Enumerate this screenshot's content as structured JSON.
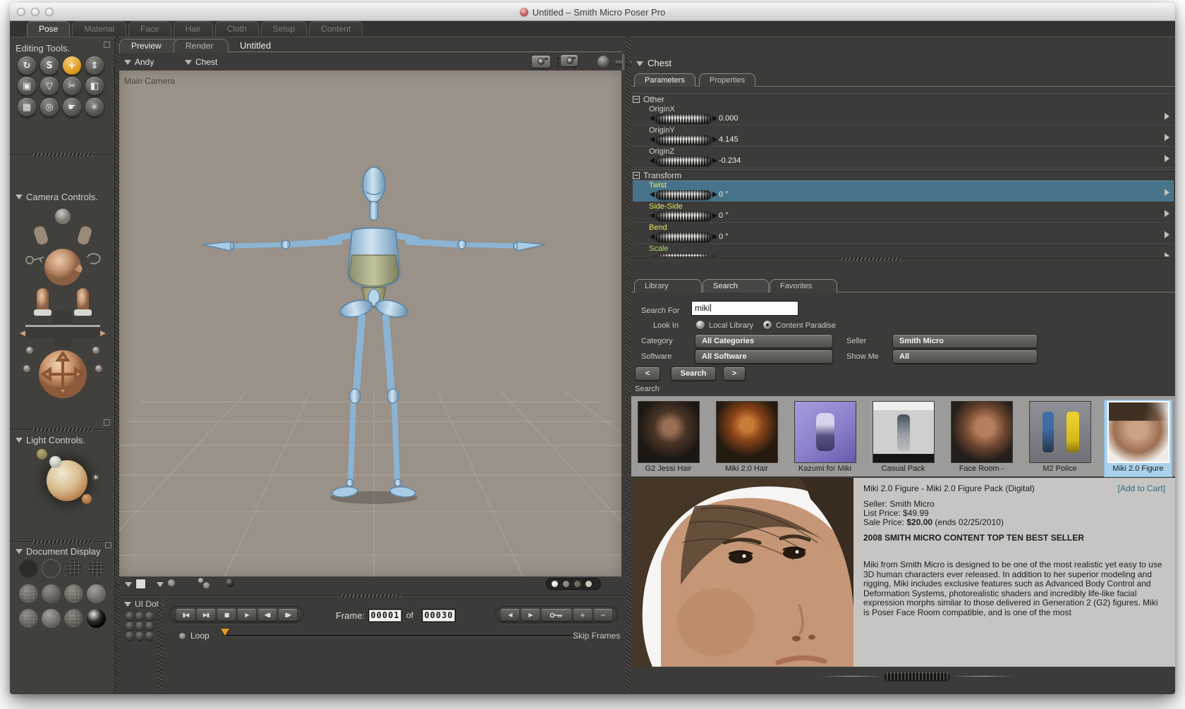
{
  "window": {
    "title": "Untitled – Smith Micro Poser Pro"
  },
  "main_tabs": {
    "items": [
      "Pose",
      "Material",
      "Face",
      "Hair",
      "Cloth",
      "Setup",
      "Content"
    ],
    "active": "Pose"
  },
  "sidebar": {
    "editing_tools_label": "Editing Tools.",
    "camera_controls_label": "Camera Controls.",
    "light_controls_label": "Light Controls.",
    "document_display_label": "Document Display"
  },
  "icons": {
    "rotate": "↻",
    "twist": "S",
    "translate": "+",
    "translate_in_out": "⇕",
    "scale": "▣",
    "taper": "▽",
    "chain_break": "✂",
    "color": "◧",
    "morph": "▦",
    "magnify": "◎",
    "group": "☛",
    "direct_manipulation": "✳",
    "sun": "☀",
    "prev": "◀",
    "next": "▶",
    "plus": "+",
    "minus": "−"
  },
  "document": {
    "tabs": [
      "Preview",
      "Render"
    ],
    "active_tab": "Preview",
    "title": "Untitled",
    "figure": "Andy",
    "element": "Chest",
    "camera_label": "Main Camera"
  },
  "animation": {
    "ui_dots_label": "UI Dots",
    "transport_icons": [
      "▮◀",
      "▶▮",
      "■",
      "▶",
      "◀▮",
      "▮▶"
    ],
    "frame_label": "Frame:",
    "current": "00001",
    "of_label": "of",
    "total": "00030",
    "loop_label": "Loop",
    "skip_frames_label": "Skip Frames"
  },
  "parameters": {
    "element": "Chest",
    "tabs": [
      "Parameters",
      "Properties"
    ],
    "active_tab": "Parameters",
    "selected_param": "Twist",
    "groups": [
      {
        "name": "Other",
        "params": [
          {
            "label": "OriginX",
            "value": "0.000"
          },
          {
            "label": "OriginY",
            "value": "4.145"
          },
          {
            "label": "OriginZ",
            "value": "-0.234"
          }
        ]
      },
      {
        "name": "Transform",
        "params": [
          {
            "label": "Twist",
            "value": "0 °"
          },
          {
            "label": "Side-Side",
            "value": "0 °"
          },
          {
            "label": "Bend",
            "value": "0 °"
          },
          {
            "label": "Scale",
            "value": ""
          }
        ]
      }
    ]
  },
  "library": {
    "tabs": [
      "Library",
      "Search",
      "Favorites"
    ],
    "active_tab": "Search",
    "search_form": {
      "search_for_label": "Search For",
      "query": "miki",
      "look_in_label": "Look In",
      "option_local": "Local Library",
      "option_paradise": "Content Paradise",
      "selected_option": "Content Paradise",
      "category_label": "Category",
      "category": "All Categories",
      "seller_label": "Seller",
      "seller": "Smith Micro",
      "software_label": "Software",
      "software": "All Software",
      "show_me_label": "Show Me",
      "show_me": "All",
      "prev": "<",
      "search": "Search",
      "next": ">"
    },
    "results_label": "Search",
    "results": [
      {
        "caption": "G2 Jessi Hair"
      },
      {
        "caption": "Miki 2.0 Hair"
      },
      {
        "caption": "Kazumi for Miki"
      },
      {
        "caption": "Casual Pack"
      },
      {
        "caption": "Face Room -"
      },
      {
        "caption": "M2 Police"
      },
      {
        "caption": "Miki 2.0 Figure",
        "selected": true
      }
    ],
    "detail": {
      "title": "Miki 2.0 Figure - Miki 2.0 Figure Pack (Digital)",
      "add_to_cart": "[Add to Cart]",
      "seller": "Seller: Smith Micro",
      "list_price": "List Price: $49.99",
      "sale_price_label": "Sale Price:",
      "sale_price": "$20.00",
      "sale_note": "(ends 02/25/2010)",
      "banner": "2008 SMITH MICRO CONTENT TOP TEN BEST SELLER",
      "description": "Miki from Smith Micro is designed to be one of the most realistic yet easy to use 3D human characters ever released. In addition to her superior modeling and rigging, Miki includes exclusive features such as Advanced Body Control and Deformation Systems, photorealistic shaders and incredibly life-like facial expression morphs similar to those delivered in Generation 2 (G2) figures. Miki is Poser Face Room compatible, and is one of the most"
    }
  }
}
